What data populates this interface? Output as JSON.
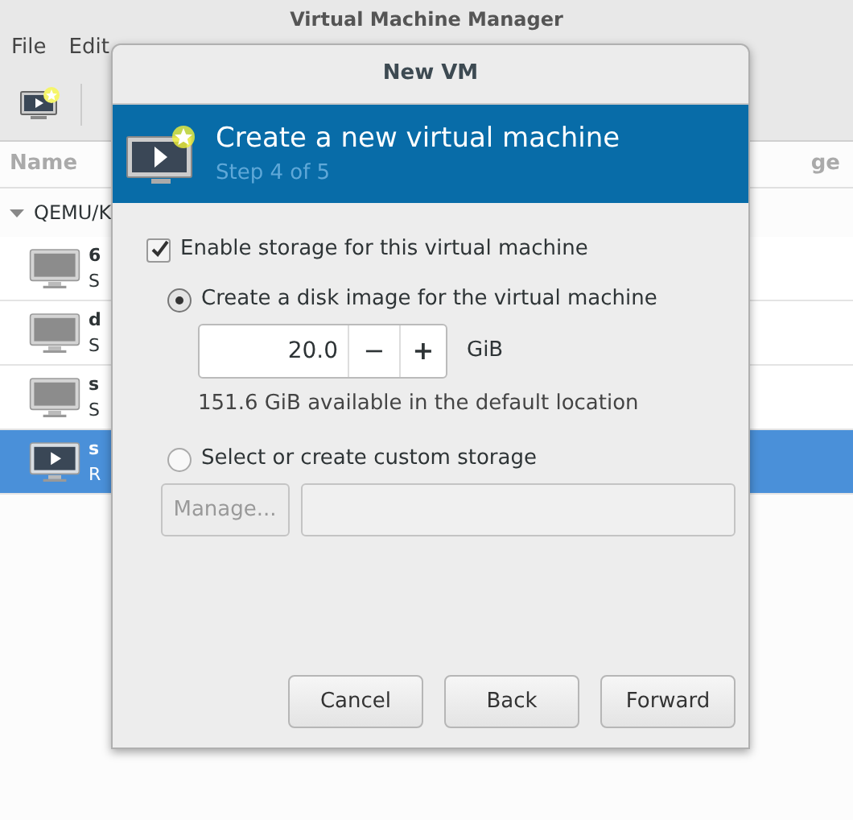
{
  "window": {
    "title": "Virtual Machine Manager"
  },
  "menu": [
    "File",
    "Edit"
  ],
  "list": {
    "columns": [
      "Name",
      "ge"
    ],
    "connection": {
      "label": "QEMU/K",
      "expanded": true
    },
    "vms": [
      {
        "name": "6",
        "status": "S",
        "running": false,
        "selected": false
      },
      {
        "name": "d",
        "status": "S",
        "running": false,
        "selected": false
      },
      {
        "name": "s",
        "status": "S",
        "running": false,
        "selected": false
      },
      {
        "name": "s",
        "status": "R",
        "running": true,
        "selected": true
      }
    ]
  },
  "dialog": {
    "title": "New VM",
    "header": {
      "title": "Create a new virtual machine",
      "step": "Step 4 of 5"
    },
    "enable_storage": {
      "label": "Enable storage for this virtual machine",
      "checked": true
    },
    "options": [
      {
        "label": "Create a disk image for the virtual machine",
        "selected": true
      },
      {
        "label": "Select or create custom storage",
        "selected": false
      }
    ],
    "disk_size": {
      "value": "20.0",
      "decrement": "−",
      "increment": "+",
      "unit": "GiB"
    },
    "available": "151.6 GiB available in the default location",
    "manage_button": {
      "label": "Manage...",
      "disabled": true
    },
    "path_field": {
      "disabled": true
    },
    "buttons": [
      "Cancel",
      "Back",
      "Forward"
    ]
  }
}
